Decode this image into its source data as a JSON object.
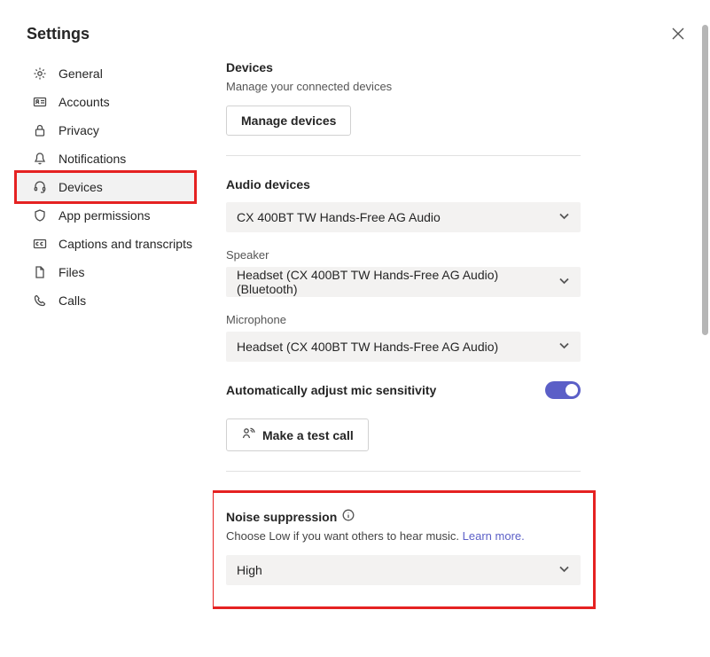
{
  "title": "Settings",
  "nav": [
    {
      "id": "general",
      "label": "General"
    },
    {
      "id": "accounts",
      "label": "Accounts"
    },
    {
      "id": "privacy",
      "label": "Privacy"
    },
    {
      "id": "notifications",
      "label": "Notifications"
    },
    {
      "id": "devices",
      "label": "Devices",
      "active": true,
      "highlight": true
    },
    {
      "id": "permissions",
      "label": "App permissions"
    },
    {
      "id": "captions",
      "label": "Captions and transcripts"
    },
    {
      "id": "files",
      "label": "Files"
    },
    {
      "id": "calls",
      "label": "Calls"
    }
  ],
  "devices": {
    "heading": "Devices",
    "sub": "Manage your connected devices",
    "manage_btn": "Manage devices"
  },
  "audio": {
    "heading": "Audio devices",
    "device_value": "CX 400BT TW Hands-Free AG Audio",
    "speaker_label": "Speaker",
    "speaker_value": "Headset (CX 400BT TW Hands-Free AG Audio) (Bluetooth)",
    "mic_label": "Microphone",
    "mic_value": "Headset (CX 400BT TW Hands-Free AG Audio)",
    "auto_label": "Automatically adjust mic sensitivity",
    "test_call": "Make a test call"
  },
  "noise": {
    "heading": "Noise suppression",
    "desc": "Choose Low if you want others to hear music.",
    "learn": "Learn more.",
    "value": "High"
  }
}
